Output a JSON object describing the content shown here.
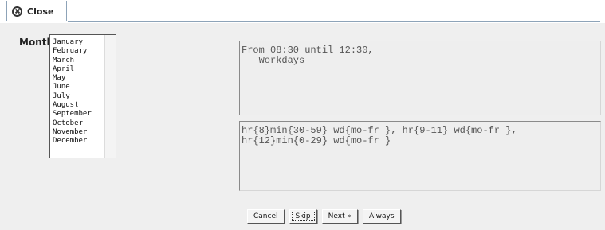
{
  "toolbar": {
    "close_label": "Close"
  },
  "month": {
    "label": "Month",
    "options": [
      "January",
      "February",
      "March",
      "April",
      "May",
      "June",
      "July",
      "August",
      "September",
      "October",
      "November",
      "December"
    ]
  },
  "readable_box": {
    "text": "From 08:30 until 12:30,\n   Workdays"
  },
  "expression_box": {
    "text": "hr{8}min{30-59} wd{mo-fr }, hr{9-11} wd{mo-fr },\nhr{12}min{0-29} wd{mo-fr }"
  },
  "buttons": {
    "cancel": "Cancel",
    "skip": "Skip",
    "next": "Next »",
    "always": "Always"
  }
}
